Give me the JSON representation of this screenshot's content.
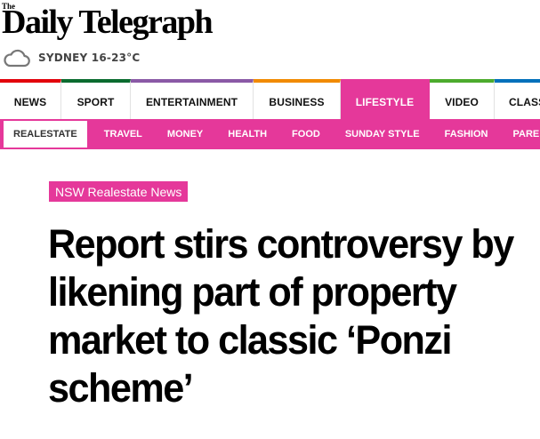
{
  "masthead": {
    "logo_the": "The",
    "logo_name": "Daily Telegraph"
  },
  "weather": {
    "icon": "cloud-icon",
    "text": "SYDNEY 16-23°C"
  },
  "primary_nav": {
    "items": [
      {
        "label": "NEWS",
        "accent": "#e2000b",
        "active": false
      },
      {
        "label": "SPORT",
        "accent": "#0a6b2f",
        "active": false
      },
      {
        "label": "ENTERTAINMENT",
        "accent": "#8a59a6",
        "active": false
      },
      {
        "label": "BUSINESS",
        "accent": "#f18a00",
        "active": false
      },
      {
        "label": "LIFESTYLE",
        "accent": "#e5389a",
        "active": true
      },
      {
        "label": "VIDEO",
        "accent": "#4cab2d",
        "active": false
      },
      {
        "label": "CLASS",
        "accent": "#0070bb",
        "active": false
      }
    ]
  },
  "sub_nav": {
    "items": [
      {
        "label": "REALESTATE",
        "active": true
      },
      {
        "label": "TRAVEL",
        "active": false
      },
      {
        "label": "MONEY",
        "active": false
      },
      {
        "label": "HEALTH",
        "active": false
      },
      {
        "label": "FOOD",
        "active": false
      },
      {
        "label": "SUNDAY STYLE",
        "active": false
      },
      {
        "label": "FASHION",
        "active": false
      },
      {
        "label": "PARE",
        "active": false
      }
    ]
  },
  "article": {
    "category": "NSW Realestate News",
    "headline": "Report stirs controversy by likening part of property market to classic ‘Ponzi scheme’"
  },
  "colors": {
    "lifestyle_pink": "#e5389a",
    "text": "#000000"
  }
}
